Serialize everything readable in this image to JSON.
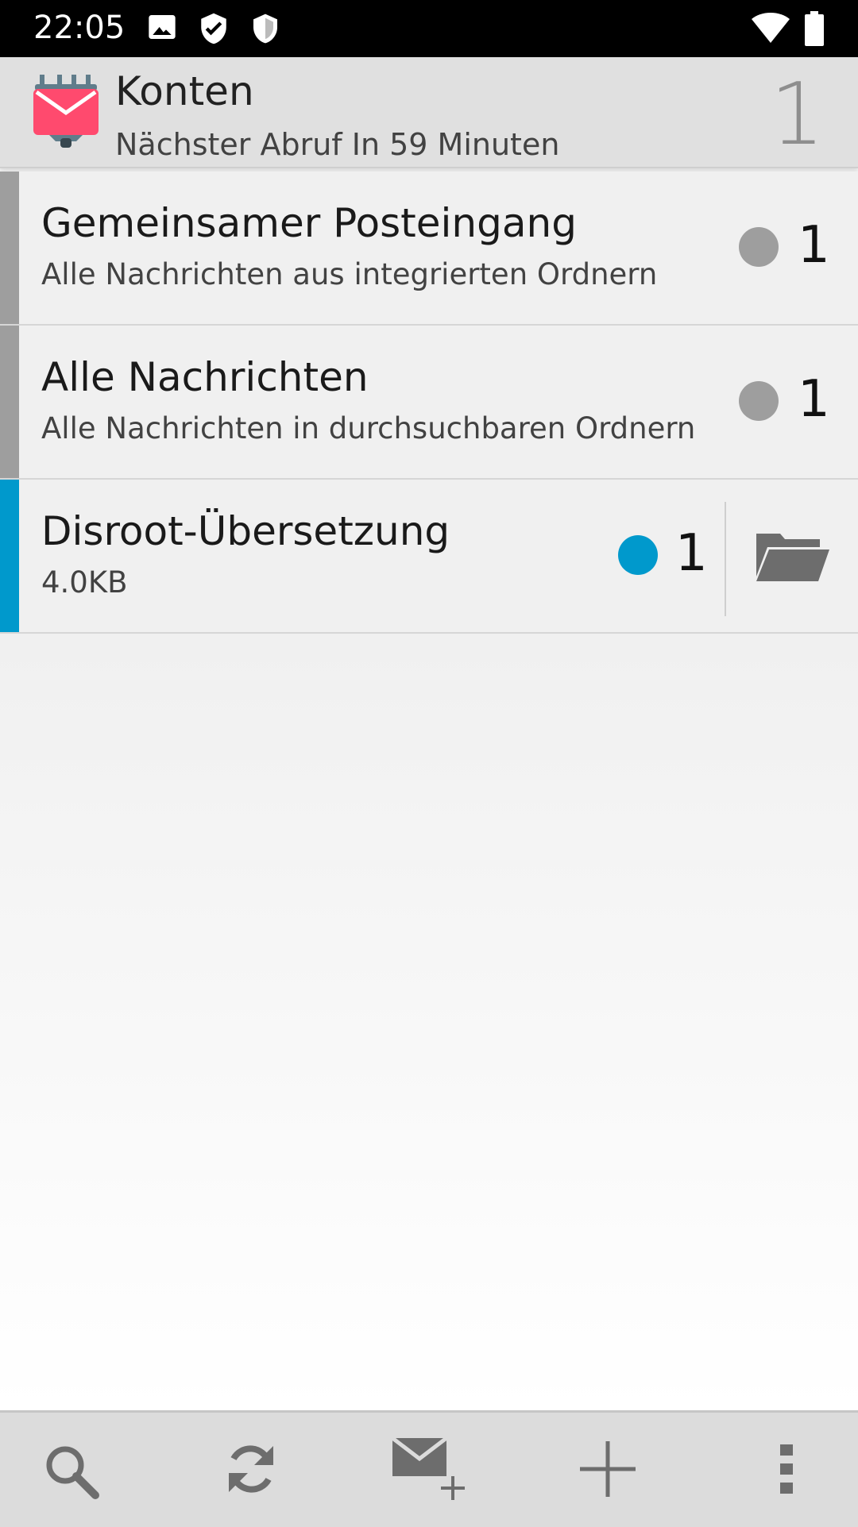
{
  "status_bar": {
    "time": "22:05",
    "icons": [
      "image-icon",
      "shield-check-icon",
      "shield-icon",
      "wifi-icon",
      "battery-icon"
    ]
  },
  "header": {
    "title": "Konten",
    "subtitle": "Nächster Abruf In 59 Minuten",
    "unread_count": "1",
    "logo": "k9-mail-logo"
  },
  "accounts": [
    {
      "title": "Gemeinsamer Posteingang",
      "subtitle": "Alle Nachrichten aus integrierten Ordnern",
      "count": "1",
      "color": "#9e9e9e"
    },
    {
      "title": "Alle Nachrichten",
      "subtitle": "Alle Nachrichten in durchsuchbaren Ordnern",
      "count": "1",
      "color": "#9e9e9e"
    },
    {
      "title": "Disroot-Übersetzung",
      "subtitle": "4.0KB",
      "count": "1",
      "color": "#0099cc"
    }
  ],
  "bottom_bar": {
    "buttons": [
      "search-icon",
      "refresh-icon",
      "compose-icon",
      "add-icon",
      "overflow-menu-icon"
    ]
  },
  "colors": {
    "header_bg": "#e0e0e0",
    "row_bg": "#f0f0f0",
    "accent": "#0099cc",
    "neutral_dot": "#9e9e9e"
  }
}
